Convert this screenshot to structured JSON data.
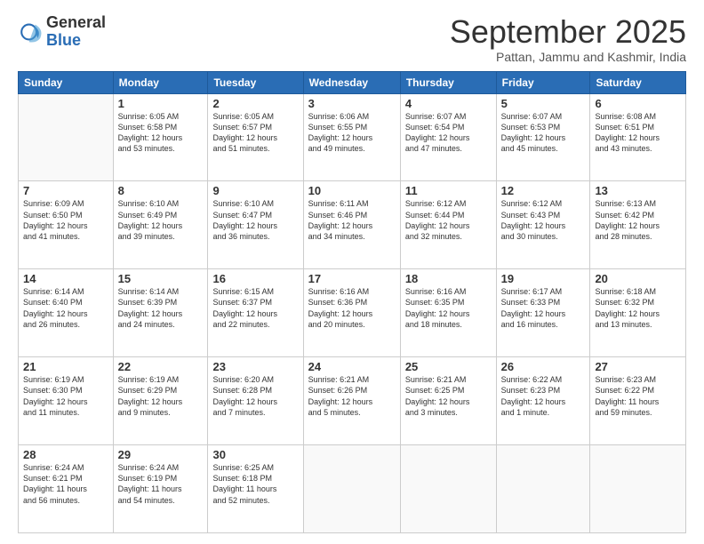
{
  "logo": {
    "general": "General",
    "blue": "Blue"
  },
  "header": {
    "month": "September 2025",
    "location": "Pattan, Jammu and Kashmir, India"
  },
  "weekdays": [
    "Sunday",
    "Monday",
    "Tuesday",
    "Wednesday",
    "Thursday",
    "Friday",
    "Saturday"
  ],
  "weeks": [
    [
      {
        "day": "",
        "info": ""
      },
      {
        "day": "1",
        "info": "Sunrise: 6:05 AM\nSunset: 6:58 PM\nDaylight: 12 hours\nand 53 minutes."
      },
      {
        "day": "2",
        "info": "Sunrise: 6:05 AM\nSunset: 6:57 PM\nDaylight: 12 hours\nand 51 minutes."
      },
      {
        "day": "3",
        "info": "Sunrise: 6:06 AM\nSunset: 6:55 PM\nDaylight: 12 hours\nand 49 minutes."
      },
      {
        "day": "4",
        "info": "Sunrise: 6:07 AM\nSunset: 6:54 PM\nDaylight: 12 hours\nand 47 minutes."
      },
      {
        "day": "5",
        "info": "Sunrise: 6:07 AM\nSunset: 6:53 PM\nDaylight: 12 hours\nand 45 minutes."
      },
      {
        "day": "6",
        "info": "Sunrise: 6:08 AM\nSunset: 6:51 PM\nDaylight: 12 hours\nand 43 minutes."
      }
    ],
    [
      {
        "day": "7",
        "info": "Sunrise: 6:09 AM\nSunset: 6:50 PM\nDaylight: 12 hours\nand 41 minutes."
      },
      {
        "day": "8",
        "info": "Sunrise: 6:10 AM\nSunset: 6:49 PM\nDaylight: 12 hours\nand 39 minutes."
      },
      {
        "day": "9",
        "info": "Sunrise: 6:10 AM\nSunset: 6:47 PM\nDaylight: 12 hours\nand 36 minutes."
      },
      {
        "day": "10",
        "info": "Sunrise: 6:11 AM\nSunset: 6:46 PM\nDaylight: 12 hours\nand 34 minutes."
      },
      {
        "day": "11",
        "info": "Sunrise: 6:12 AM\nSunset: 6:44 PM\nDaylight: 12 hours\nand 32 minutes."
      },
      {
        "day": "12",
        "info": "Sunrise: 6:12 AM\nSunset: 6:43 PM\nDaylight: 12 hours\nand 30 minutes."
      },
      {
        "day": "13",
        "info": "Sunrise: 6:13 AM\nSunset: 6:42 PM\nDaylight: 12 hours\nand 28 minutes."
      }
    ],
    [
      {
        "day": "14",
        "info": "Sunrise: 6:14 AM\nSunset: 6:40 PM\nDaylight: 12 hours\nand 26 minutes."
      },
      {
        "day": "15",
        "info": "Sunrise: 6:14 AM\nSunset: 6:39 PM\nDaylight: 12 hours\nand 24 minutes."
      },
      {
        "day": "16",
        "info": "Sunrise: 6:15 AM\nSunset: 6:37 PM\nDaylight: 12 hours\nand 22 minutes."
      },
      {
        "day": "17",
        "info": "Sunrise: 6:16 AM\nSunset: 6:36 PM\nDaylight: 12 hours\nand 20 minutes."
      },
      {
        "day": "18",
        "info": "Sunrise: 6:16 AM\nSunset: 6:35 PM\nDaylight: 12 hours\nand 18 minutes."
      },
      {
        "day": "19",
        "info": "Sunrise: 6:17 AM\nSunset: 6:33 PM\nDaylight: 12 hours\nand 16 minutes."
      },
      {
        "day": "20",
        "info": "Sunrise: 6:18 AM\nSunset: 6:32 PM\nDaylight: 12 hours\nand 13 minutes."
      }
    ],
    [
      {
        "day": "21",
        "info": "Sunrise: 6:19 AM\nSunset: 6:30 PM\nDaylight: 12 hours\nand 11 minutes."
      },
      {
        "day": "22",
        "info": "Sunrise: 6:19 AM\nSunset: 6:29 PM\nDaylight: 12 hours\nand 9 minutes."
      },
      {
        "day": "23",
        "info": "Sunrise: 6:20 AM\nSunset: 6:28 PM\nDaylight: 12 hours\nand 7 minutes."
      },
      {
        "day": "24",
        "info": "Sunrise: 6:21 AM\nSunset: 6:26 PM\nDaylight: 12 hours\nand 5 minutes."
      },
      {
        "day": "25",
        "info": "Sunrise: 6:21 AM\nSunset: 6:25 PM\nDaylight: 12 hours\nand 3 minutes."
      },
      {
        "day": "26",
        "info": "Sunrise: 6:22 AM\nSunset: 6:23 PM\nDaylight: 12 hours\nand 1 minute."
      },
      {
        "day": "27",
        "info": "Sunrise: 6:23 AM\nSunset: 6:22 PM\nDaylight: 11 hours\nand 59 minutes."
      }
    ],
    [
      {
        "day": "28",
        "info": "Sunrise: 6:24 AM\nSunset: 6:21 PM\nDaylight: 11 hours\nand 56 minutes."
      },
      {
        "day": "29",
        "info": "Sunrise: 6:24 AM\nSunset: 6:19 PM\nDaylight: 11 hours\nand 54 minutes."
      },
      {
        "day": "30",
        "info": "Sunrise: 6:25 AM\nSunset: 6:18 PM\nDaylight: 11 hours\nand 52 minutes."
      },
      {
        "day": "",
        "info": ""
      },
      {
        "day": "",
        "info": ""
      },
      {
        "day": "",
        "info": ""
      },
      {
        "day": "",
        "info": ""
      }
    ]
  ]
}
